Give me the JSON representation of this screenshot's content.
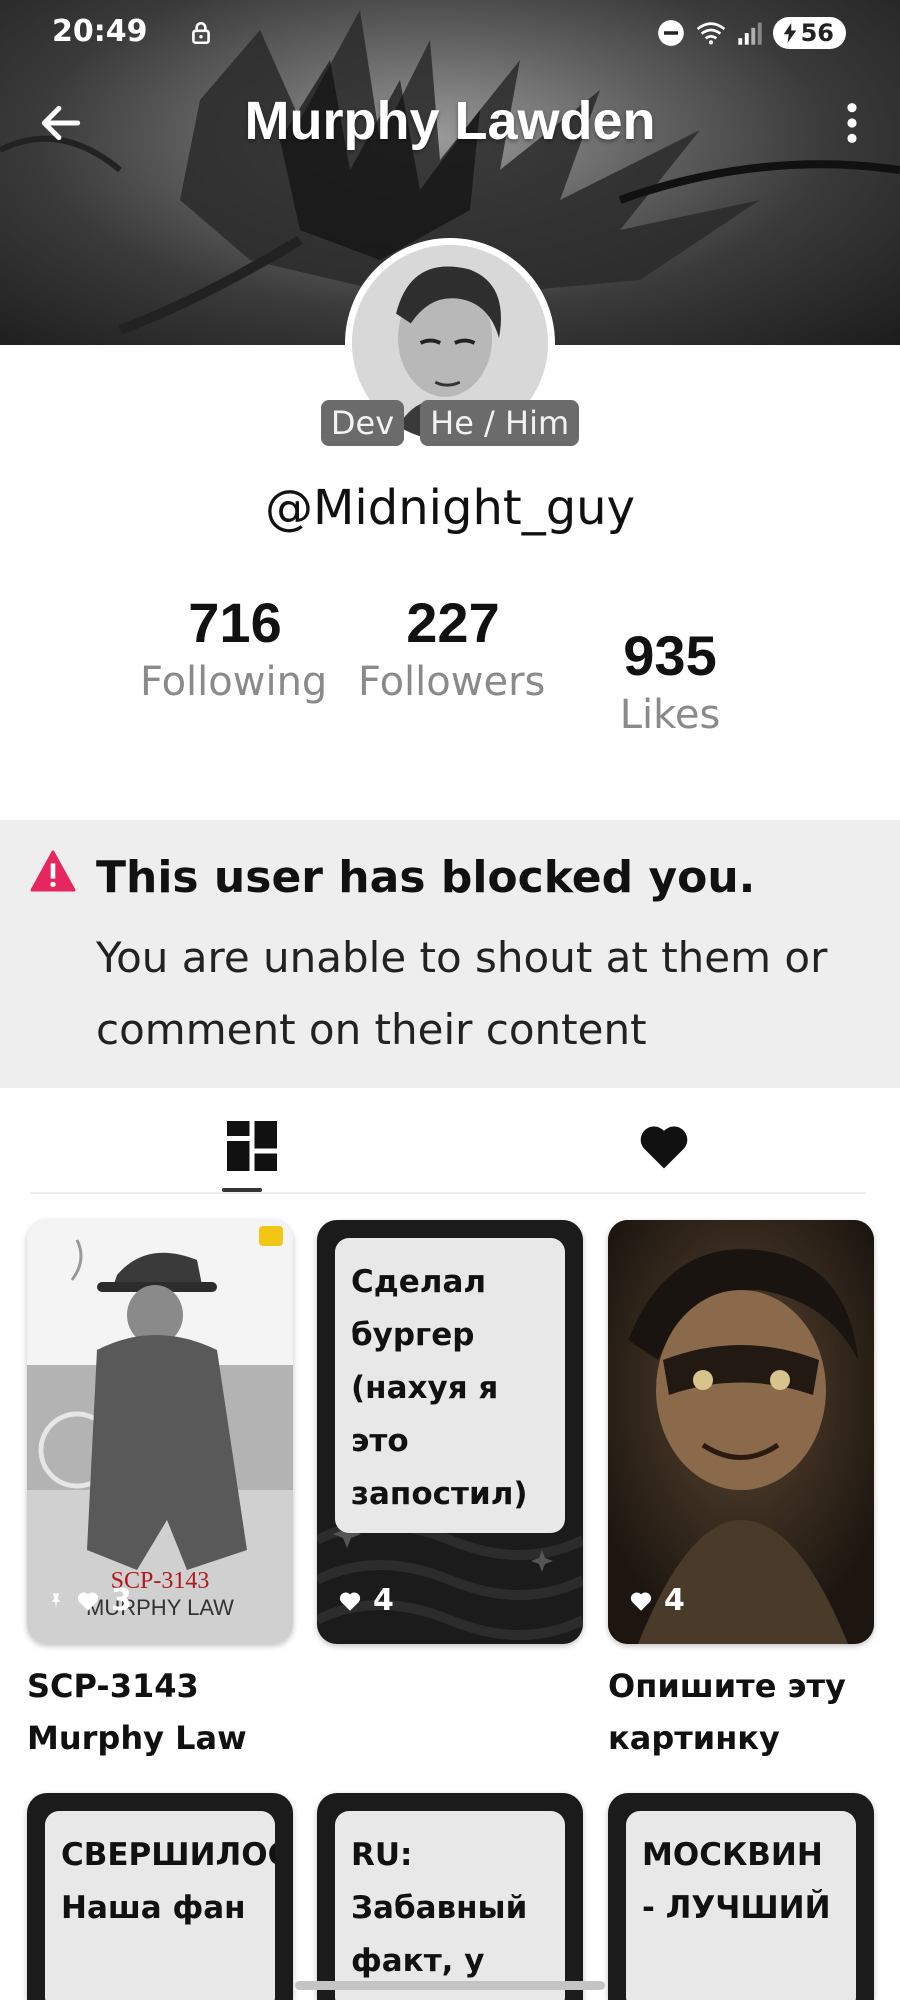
{
  "status_bar": {
    "time": "20:49",
    "battery": "56"
  },
  "header": {
    "title": "Murphy Lawden"
  },
  "profile": {
    "tags": [
      "Dev",
      "He / Him"
    ],
    "handle": "@Midnight_guy",
    "stats": [
      {
        "value": "716",
        "label": "Following"
      },
      {
        "value": "227",
        "label": "Followers"
      },
      {
        "value": "935",
        "label": "Likes"
      }
    ]
  },
  "blocked_notice": {
    "title": "This user has blocked you.",
    "text": "You are unable to shout at them or comment on their content"
  },
  "tabs": [
    {
      "icon": "grid-icon",
      "active": true
    },
    {
      "icon": "heart-icon",
      "active": false
    }
  ],
  "posts": [
    {
      "type": "image",
      "image_text": [
        "SCP-3143",
        "MURPHY LAW"
      ],
      "likes": "3",
      "caption": "SCP-3143 Murphy Law",
      "pinned": true
    },
    {
      "type": "text",
      "text": "Сделал бургер (нахуя я это запостил)",
      "likes": "4",
      "caption": ""
    },
    {
      "type": "image",
      "likes": "4",
      "caption": "Опишите эту картинку"
    },
    {
      "type": "text",
      "text": "СВЕРШИЛОСЬ! Наша фан",
      "likes": "",
      "caption": ""
    },
    {
      "type": "text",
      "text": "RU: Забавный факт, у",
      "likes": "",
      "caption": ""
    },
    {
      "type": "text",
      "text": "МОСКВИН - ЛУЧШИЙ",
      "likes": "",
      "caption": ""
    }
  ],
  "colors": {
    "warning": "#e8265e",
    "blocked_bg": "#eeeeee",
    "tag_bg": "#6b6b6b"
  }
}
